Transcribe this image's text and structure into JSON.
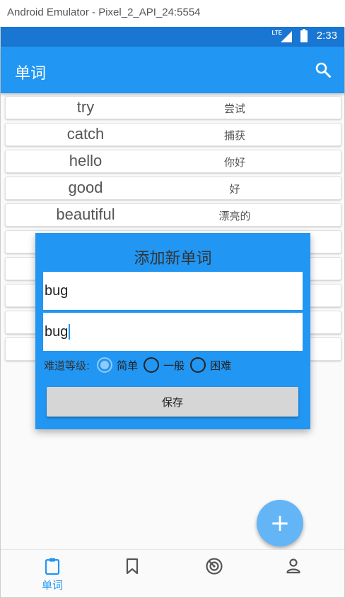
{
  "window": {
    "title": "Android Emulator - Pixel_2_API_24:5554"
  },
  "status_bar": {
    "network": "LTE",
    "time": "2:33"
  },
  "app_bar": {
    "title": "单词",
    "search_icon": "search-icon"
  },
  "words": [
    {
      "en": "try",
      "cn": "尝试"
    },
    {
      "en": "catch",
      "cn": "捕获"
    },
    {
      "en": "hello",
      "cn": "你好"
    },
    {
      "en": "good",
      "cn": "好"
    },
    {
      "en": "beautiful",
      "cn": "漂亮的"
    },
    {
      "en": "",
      "cn": ""
    },
    {
      "en": "",
      "cn": ""
    },
    {
      "en": "",
      "cn": ""
    },
    {
      "en": "",
      "cn": ""
    },
    {
      "en": "",
      "cn": ""
    }
  ],
  "dialog": {
    "title": "添加新单词",
    "word_value": "bug",
    "meaning_value": "bug",
    "difficulty_label": "难道等级:",
    "options": [
      {
        "label": "简单",
        "selected": true
      },
      {
        "label": "一般",
        "selected": false
      },
      {
        "label": "困难",
        "selected": false
      }
    ],
    "save_label": "保存"
  },
  "fab": {
    "label": "+",
    "icon": "plus-icon"
  },
  "bottom_nav": {
    "items": [
      {
        "label": "单词",
        "icon": "clipboard-icon",
        "active": true
      },
      {
        "label": "",
        "icon": "bookmark-icon",
        "active": false
      },
      {
        "label": "",
        "icon": "radar-icon",
        "active": false
      },
      {
        "label": "",
        "icon": "person-icon",
        "active": false
      }
    ]
  },
  "colors": {
    "primary": "#2196f3",
    "status_bar": "#1976d2",
    "fab": "#64b5f6",
    "radio_selected": "#90caf9"
  }
}
